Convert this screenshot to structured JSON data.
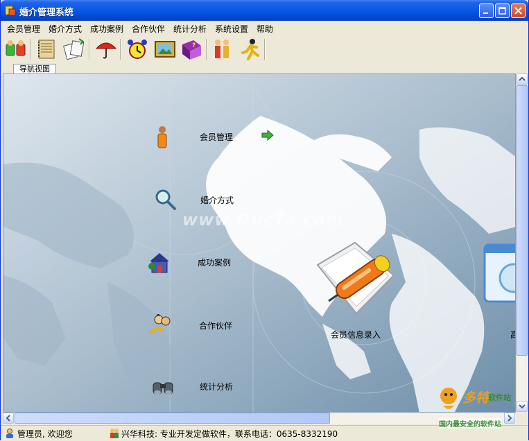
{
  "window": {
    "title": "婚介管理系统"
  },
  "menu": [
    "会员管理",
    "婚介方式",
    "成功案例",
    "合作伙伴",
    "统计分析",
    "系统设置",
    "帮助"
  ],
  "toolbar": {
    "icons": [
      "members-icon",
      "notebook-icon",
      "files-icon",
      "umbrella-icon",
      "alarm-clock-icon",
      "picture-icon",
      "help-book-icon",
      "people-icon",
      "runner-icon"
    ]
  },
  "tab": {
    "label": "导航视图"
  },
  "nav": {
    "items": [
      {
        "label": "会员管理",
        "icon": "member-person-icon"
      },
      {
        "label": "婚介方式",
        "icon": "magnifier-icon"
      },
      {
        "label": "成功案例",
        "icon": "house-icon"
      },
      {
        "label": "合作伙伴",
        "icon": "partners-icon"
      },
      {
        "label": "统计分析",
        "icon": "binoculars-icon"
      }
    ],
    "feature_label": "会员信息录入",
    "partial_label": "高"
  },
  "status": {
    "user": "管理员, 欢迎您",
    "company": "兴华科技: 专业开发定做软件，联系电话：0635-8332190"
  },
  "watermarks": {
    "center": "www.DucTe.com",
    "corner_main": "多特",
    "corner_sub": "软件站",
    "corner_slogan": "国内最安全的软件站"
  },
  "colors": {
    "titlebar": "#0a5ae8",
    "accent_orange": "#f07a1a",
    "arrow_green": "#3db33d"
  }
}
